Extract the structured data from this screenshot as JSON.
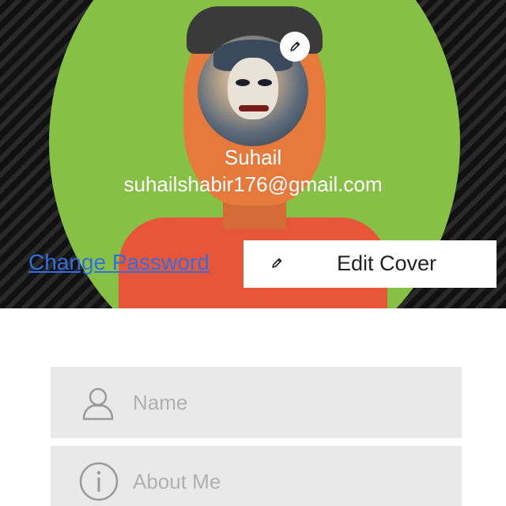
{
  "profile": {
    "name": "Suhail",
    "email": "suhailshabir176@gmail.com"
  },
  "actions": {
    "change_password": "Change Password",
    "edit_cover": "Edit Cover"
  },
  "form": {
    "name_placeholder": "Name",
    "about_placeholder": "About Me"
  },
  "icons": {
    "avatar_edit": "pencil-icon",
    "edit_cover": "pencil-icon",
    "name_field": "user-icon",
    "about_field": "info-icon"
  },
  "colors": {
    "link": "#2f6fe0",
    "field_bg": "#e9e9e9",
    "placeholder": "#b0b0b0"
  }
}
